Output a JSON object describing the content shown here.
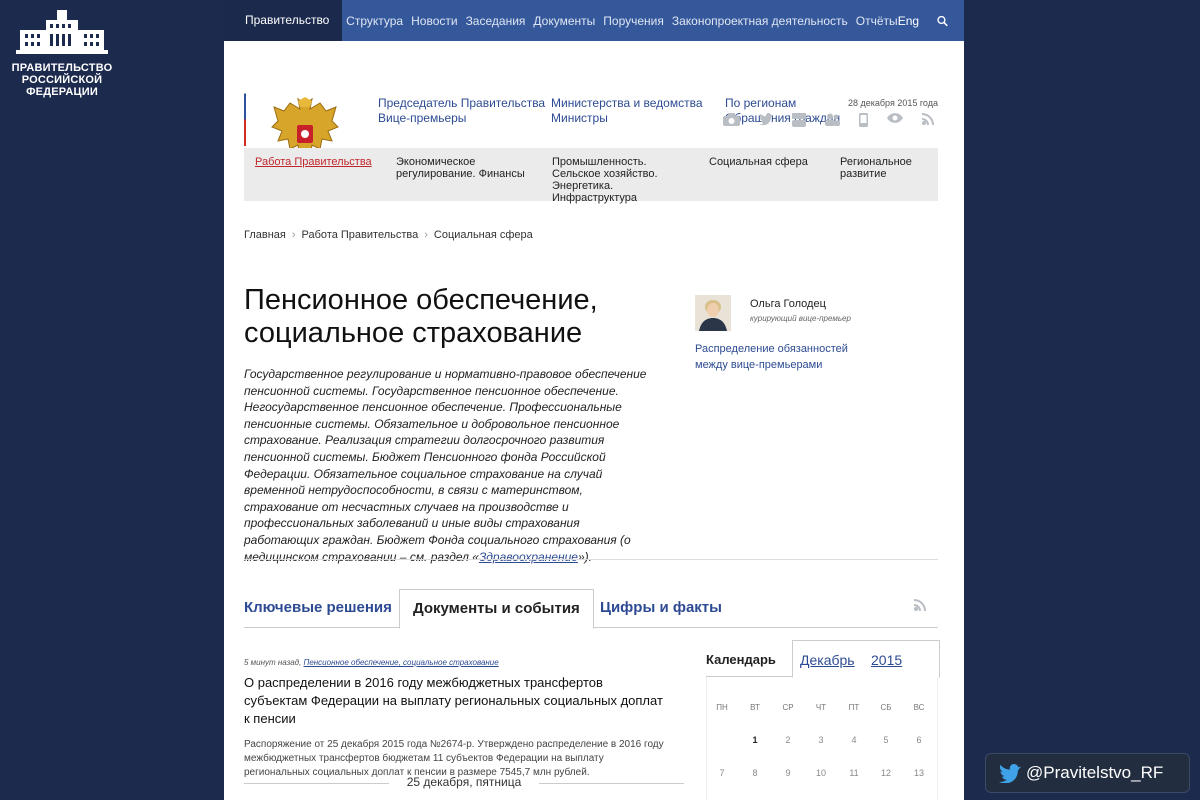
{
  "logo": {
    "lines": [
      "ПРАВИТЕЛЬСТВО",
      "РОССИЙСКОЙ",
      "ФЕДЕРАЦИИ"
    ]
  },
  "topnav": {
    "active": "Правительство России",
    "items": [
      "Структура",
      "Новости",
      "Заседания",
      "Документы",
      "Поручения",
      "Законопроектная деятельность",
      "Отчёты"
    ],
    "lang": "Eng"
  },
  "header": {
    "col1": [
      "Председатель Правительства",
      "Вице-премьеры"
    ],
    "col2": [
      "Министерства и ведомства",
      "Министры"
    ],
    "col3": [
      "По регионам",
      "Обращения граждан"
    ],
    "date": "28 декабря 2015 года",
    "social_icons": [
      "camera-icon",
      "twitter-icon",
      "youtube-icon",
      "users-icon",
      "mobile-icon",
      "eye-icon",
      "rss-icon"
    ]
  },
  "subnav": [
    {
      "label": "Работа Правительства",
      "current": true
    },
    {
      "label": "Экономическое регулирование. Финансы"
    },
    {
      "label": "Промышленность. Сельское хозяйство. Энергетика. Инфраструктура"
    },
    {
      "label": "Социальная сфера"
    },
    {
      "label": "Региональное развитие"
    }
  ],
  "breadcrumbs": [
    "Главная",
    "Работа Правительства",
    "Социальная сфера"
  ],
  "page": {
    "title": "Пенсионное обеспечение, социальное страхование",
    "description": "Государственное регулирование и нормативно-правовое обеспечение пенсионной системы. Государственное пенсионное обеспечение. Негосударственное пенсионное обеспечение. Профессиональные пенсионные системы. Обязательное и добровольное пенсионное страхование. Реализация стратегии долгосрочного развития пенсионной системы. Бюджет Пенсионного фонда Российской Федерации. Обязательное социальное страхование на случай временной нетрудоспособности, в связи с материнством, страхование от несчастных случаев на производстве и профессиональных заболеваний и иные виды страхования работающих граждан. Бюджет Фонда социального страхования (о медицинском страховании – см. раздел «",
    "description_link": "Здравоохранение",
    "description_end": "»)."
  },
  "curator": {
    "name": "Ольга Голодец",
    "role": "курирующий вице-премьер",
    "link": "Распределение обязанностей между вице-премьерами"
  },
  "tabs": [
    {
      "label": "Ключевые решения"
    },
    {
      "label": "Документы и события",
      "active": true
    },
    {
      "label": "Цифры и факты"
    }
  ],
  "news": {
    "time": "5 минут назад,",
    "category": "Пенсионное обеспечение, социальное страхование",
    "title": "О распределении в 2016 году межбюджетных трансфертов субъектам Федерации на выплату региональных социальных доплат к пенсии",
    "text": "Распоряжение от 25 декабря 2015 года №2674-р. Утверждено распределение в 2016 году межбюджетных трансфертов бюджетам 11 субъектов Федерации на выплату региональных социальных доплат к пенсии в размере 7545,7 млн рублей."
  },
  "dateline": "25 декабря, пятница",
  "calendar": {
    "label": "Календарь",
    "month": "Декабрь",
    "year": "2015",
    "weekdays": [
      "ПН",
      "ВТ",
      "СР",
      "ЧТ",
      "ПТ",
      "СБ",
      "ВС"
    ],
    "days": [
      "",
      "1",
      "2",
      "3",
      "4",
      "5",
      "6",
      "7",
      "8",
      "9",
      "10",
      "11",
      "12",
      "13"
    ]
  },
  "twitter": {
    "handle": "@Pravitelstvo_RF"
  },
  "colors": {
    "brand_blue": "#35589b",
    "dark_navy": "#1c2a4d",
    "link": "#2d4b93",
    "current": "#c0272d"
  }
}
